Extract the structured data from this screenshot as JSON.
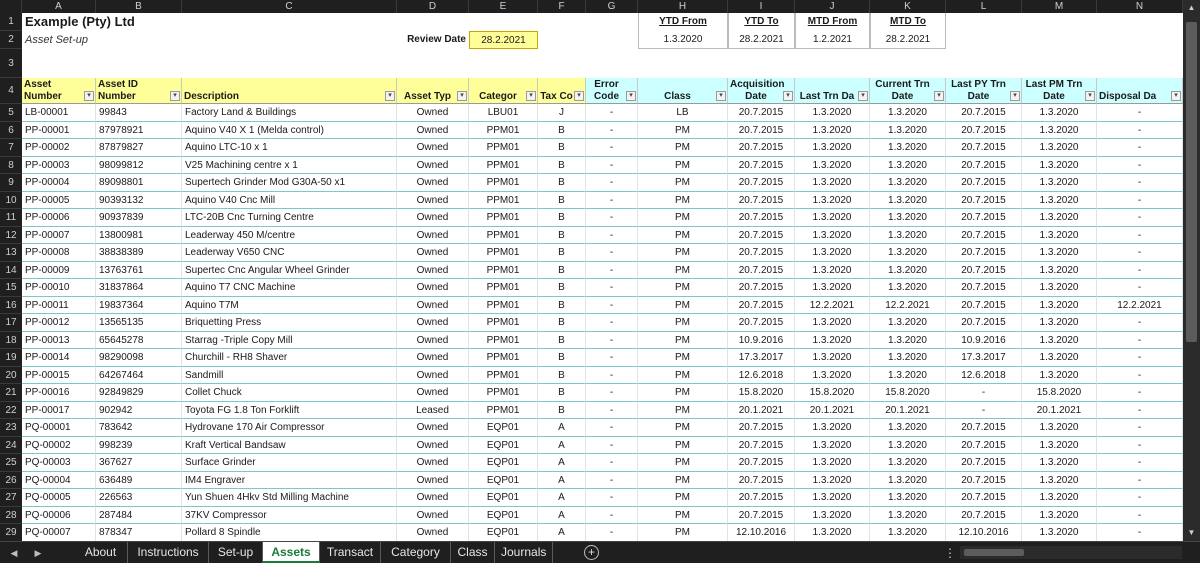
{
  "columns": [
    "A",
    "B",
    "C",
    "D",
    "E",
    "F",
    "G",
    "H",
    "I",
    "J",
    "K",
    "L",
    "M",
    "N"
  ],
  "company": "Example (Pty) Ltd",
  "subtitle": "Asset Set-up",
  "review_label": "Review Date",
  "review_date": "28.2.2021",
  "period_headers": {
    "ytd_from": "YTD From",
    "ytd_to": "YTD To",
    "mtd_from": "MTD From",
    "mtd_to": "MTD To"
  },
  "period_values": {
    "ytd_from": "1.3.2020",
    "ytd_to": "28.2.2021",
    "mtd_from": "1.2.2021",
    "mtd_to": "28.2.2021"
  },
  "headers": {
    "A": [
      "Asset",
      "Number"
    ],
    "B": [
      "Asset ID",
      "Number"
    ],
    "C": [
      "",
      "Description"
    ],
    "D": [
      "",
      "Asset Typ"
    ],
    "E": [
      "",
      "Categor"
    ],
    "F": [
      "",
      "Tax Co"
    ],
    "G": [
      "Error",
      "Code"
    ],
    "H": [
      "",
      "Class"
    ],
    "I": [
      "Acquisition",
      "Date"
    ],
    "J": [
      "",
      "Last Trn Da"
    ],
    "K": [
      "Current Trn",
      "Date"
    ],
    "L": [
      "Last PY Trn",
      "Date"
    ],
    "M": [
      "Last PM Trn",
      "Date"
    ],
    "N": [
      "",
      "Disposal Da"
    ]
  },
  "rows": [
    {
      "n": "5",
      "a": "LB-00001",
      "b": "99843",
      "c": "Factory Land & Buildings",
      "d": "Owned",
      "e": "LBU01",
      "f": "J",
      "g": "-",
      "h": "LB",
      "i": "20.7.2015",
      "j": "1.3.2020",
      "k": "1.3.2020",
      "l": "20.7.2015",
      "m": "1.3.2020",
      "o": "-"
    },
    {
      "n": "6",
      "a": "PP-00001",
      "b": "87978921",
      "c": "Aquino V40 X 1 (Melda control)",
      "d": "Owned",
      "e": "PPM01",
      "f": "B",
      "g": "-",
      "h": "PM",
      "i": "20.7.2015",
      "j": "1.3.2020",
      "k": "1.3.2020",
      "l": "20.7.2015",
      "m": "1.3.2020",
      "o": "-"
    },
    {
      "n": "7",
      "a": "PP-00002",
      "b": "87879827",
      "c": "Aquino LTC-10 x 1",
      "d": "Owned",
      "e": "PPM01",
      "f": "B",
      "g": "-",
      "h": "PM",
      "i": "20.7.2015",
      "j": "1.3.2020",
      "k": "1.3.2020",
      "l": "20.7.2015",
      "m": "1.3.2020",
      "o": "-"
    },
    {
      "n": "8",
      "a": "PP-00003",
      "b": "98099812",
      "c": "V25 Machining centre x 1",
      "d": "Owned",
      "e": "PPM01",
      "f": "B",
      "g": "-",
      "h": "PM",
      "i": "20.7.2015",
      "j": "1.3.2020",
      "k": "1.3.2020",
      "l": "20.7.2015",
      "m": "1.3.2020",
      "o": "-"
    },
    {
      "n": "9",
      "a": "PP-00004",
      "b": "89098801",
      "c": "Supertech Grinder Mod G30A-50 x1",
      "d": "Owned",
      "e": "PPM01",
      "f": "B",
      "g": "-",
      "h": "PM",
      "i": "20.7.2015",
      "j": "1.3.2020",
      "k": "1.3.2020",
      "l": "20.7.2015",
      "m": "1.3.2020",
      "o": "-"
    },
    {
      "n": "10",
      "a": "PP-00005",
      "b": "90393132",
      "c": "Aquino V40 Cnc Mill",
      "d": "Owned",
      "e": "PPM01",
      "f": "B",
      "g": "-",
      "h": "PM",
      "i": "20.7.2015",
      "j": "1.3.2020",
      "k": "1.3.2020",
      "l": "20.7.2015",
      "m": "1.3.2020",
      "o": "-"
    },
    {
      "n": "11",
      "a": "PP-00006",
      "b": "90937839",
      "c": "LTC-20B Cnc Turning Centre",
      "d": "Owned",
      "e": "PPM01",
      "f": "B",
      "g": "-",
      "h": "PM",
      "i": "20.7.2015",
      "j": "1.3.2020",
      "k": "1.3.2020",
      "l": "20.7.2015",
      "m": "1.3.2020",
      "o": "-"
    },
    {
      "n": "12",
      "a": "PP-00007",
      "b": "13800981",
      "c": "Leaderway 450 M/centre",
      "d": "Owned",
      "e": "PPM01",
      "f": "B",
      "g": "-",
      "h": "PM",
      "i": "20.7.2015",
      "j": "1.3.2020",
      "k": "1.3.2020",
      "l": "20.7.2015",
      "m": "1.3.2020",
      "o": "-"
    },
    {
      "n": "13",
      "a": "PP-00008",
      "b": "38838389",
      "c": "Leaderway V650 CNC",
      "d": "Owned",
      "e": "PPM01",
      "f": "B",
      "g": "-",
      "h": "PM",
      "i": "20.7.2015",
      "j": "1.3.2020",
      "k": "1.3.2020",
      "l": "20.7.2015",
      "m": "1.3.2020",
      "o": "-"
    },
    {
      "n": "14",
      "a": "PP-00009",
      "b": "13763761",
      "c": "Supertec Cnc Angular Wheel Grinder",
      "d": "Owned",
      "e": "PPM01",
      "f": "B",
      "g": "-",
      "h": "PM",
      "i": "20.7.2015",
      "j": "1.3.2020",
      "k": "1.3.2020",
      "l": "20.7.2015",
      "m": "1.3.2020",
      "o": "-"
    },
    {
      "n": "15",
      "a": "PP-00010",
      "b": "31837864",
      "c": "Aquino T7 CNC Machine",
      "d": "Owned",
      "e": "PPM01",
      "f": "B",
      "g": "-",
      "h": "PM",
      "i": "20.7.2015",
      "j": "1.3.2020",
      "k": "1.3.2020",
      "l": "20.7.2015",
      "m": "1.3.2020",
      "o": "-"
    },
    {
      "n": "16",
      "a": "PP-00011",
      "b": "19837364",
      "c": "Aquino T7M",
      "d": "Owned",
      "e": "PPM01",
      "f": "B",
      "g": "-",
      "h": "PM",
      "i": "20.7.2015",
      "j": "12.2.2021",
      "k": "12.2.2021",
      "l": "20.7.2015",
      "m": "1.3.2020",
      "o": "12.2.2021"
    },
    {
      "n": "17",
      "a": "PP-00012",
      "b": "13565135",
      "c": "Briquetting Press",
      "d": "Owned",
      "e": "PPM01",
      "f": "B",
      "g": "-",
      "h": "PM",
      "i": "20.7.2015",
      "j": "1.3.2020",
      "k": "1.3.2020",
      "l": "20.7.2015",
      "m": "1.3.2020",
      "o": "-"
    },
    {
      "n": "18",
      "a": "PP-00013",
      "b": "65645278",
      "c": "Starrag -Triple Copy Mill",
      "d": "Owned",
      "e": "PPM01",
      "f": "B",
      "g": "-",
      "h": "PM",
      "i": "10.9.2016",
      "j": "1.3.2020",
      "k": "1.3.2020",
      "l": "10.9.2016",
      "m": "1.3.2020",
      "o": "-"
    },
    {
      "n": "19",
      "a": "PP-00014",
      "b": "98290098",
      "c": "Churchill - RH8 Shaver",
      "d": "Owned",
      "e": "PPM01",
      "f": "B",
      "g": "-",
      "h": "PM",
      "i": "17.3.2017",
      "j": "1.3.2020",
      "k": "1.3.2020",
      "l": "17.3.2017",
      "m": "1.3.2020",
      "o": "-"
    },
    {
      "n": "20",
      "a": "PP-00015",
      "b": "64267464",
      "c": "Sandmill",
      "d": "Owned",
      "e": "PPM01",
      "f": "B",
      "g": "-",
      "h": "PM",
      "i": "12.6.2018",
      "j": "1.3.2020",
      "k": "1.3.2020",
      "l": "12.6.2018",
      "m": "1.3.2020",
      "o": "-"
    },
    {
      "n": "21",
      "a": "PP-00016",
      "b": "92849829",
      "c": "Collet Chuck",
      "d": "Owned",
      "e": "PPM01",
      "f": "B",
      "g": "-",
      "h": "PM",
      "i": "15.8.2020",
      "j": "15.8.2020",
      "k": "15.8.2020",
      "l": "-",
      "m": "15.8.2020",
      "o": "-"
    },
    {
      "n": "22",
      "a": "PP-00017",
      "b": "902942",
      "c": "Toyota FG 1.8 Ton Forklift",
      "d": "Leased",
      "e": "PPM01",
      "f": "B",
      "g": "-",
      "h": "PM",
      "i": "20.1.2021",
      "j": "20.1.2021",
      "k": "20.1.2021",
      "l": "-",
      "m": "20.1.2021",
      "o": "-"
    },
    {
      "n": "23",
      "a": "PQ-00001",
      "b": "783642",
      "c": "Hydrovane 170 Air Compressor",
      "d": "Owned",
      "e": "EQP01",
      "f": "A",
      "g": "-",
      "h": "PM",
      "i": "20.7.2015",
      "j": "1.3.2020",
      "k": "1.3.2020",
      "l": "20.7.2015",
      "m": "1.3.2020",
      "o": "-"
    },
    {
      "n": "24",
      "a": "PQ-00002",
      "b": "998239",
      "c": "Kraft Vertical Bandsaw",
      "d": "Owned",
      "e": "EQP01",
      "f": "A",
      "g": "-",
      "h": "PM",
      "i": "20.7.2015",
      "j": "1.3.2020",
      "k": "1.3.2020",
      "l": "20.7.2015",
      "m": "1.3.2020",
      "o": "-"
    },
    {
      "n": "25",
      "a": "PQ-00003",
      "b": "367627",
      "c": "Surface Grinder",
      "d": "Owned",
      "e": "EQP01",
      "f": "A",
      "g": "-",
      "h": "PM",
      "i": "20.7.2015",
      "j": "1.3.2020",
      "k": "1.3.2020",
      "l": "20.7.2015",
      "m": "1.3.2020",
      "o": "-"
    },
    {
      "n": "26",
      "a": "PQ-00004",
      "b": "636489",
      "c": "IM4 Engraver",
      "d": "Owned",
      "e": "EQP01",
      "f": "A",
      "g": "-",
      "h": "PM",
      "i": "20.7.2015",
      "j": "1.3.2020",
      "k": "1.3.2020",
      "l": "20.7.2015",
      "m": "1.3.2020",
      "o": "-"
    },
    {
      "n": "27",
      "a": "PQ-00005",
      "b": "226563",
      "c": "Yun Shuen 4Hkv Std Milling Machine",
      "d": "Owned",
      "e": "EQP01",
      "f": "A",
      "g": "-",
      "h": "PM",
      "i": "20.7.2015",
      "j": "1.3.2020",
      "k": "1.3.2020",
      "l": "20.7.2015",
      "m": "1.3.2020",
      "o": "-"
    },
    {
      "n": "28",
      "a": "PQ-00006",
      "b": "287484",
      "c": "37KV Compressor",
      "d": "Owned",
      "e": "EQP01",
      "f": "A",
      "g": "-",
      "h": "PM",
      "i": "20.7.2015",
      "j": "1.3.2020",
      "k": "1.3.2020",
      "l": "20.7.2015",
      "m": "1.3.2020",
      "o": "-"
    },
    {
      "n": "29",
      "a": "PQ-00007",
      "b": "878347",
      "c": "Pollard 8 Spindle",
      "d": "Owned",
      "e": "EQP01",
      "f": "A",
      "g": "-",
      "h": "PM",
      "i": "12.10.2016",
      "j": "1.3.2020",
      "k": "1.3.2020",
      "l": "12.10.2016",
      "m": "1.3.2020",
      "o": "-"
    }
  ],
  "tabs": [
    "About",
    "Instructions",
    "Set-up",
    "Assets",
    "Transact",
    "Category",
    "Class",
    "Journals"
  ],
  "active_tab": "Assets",
  "icons": {
    "prev": "triangle-left-icon",
    "next": "triangle-right-icon",
    "add": "plus-circle-icon",
    "options": "vertical-ellipsis-icon"
  },
  "colors": {
    "header_yellow": "#ffff99",
    "header_cyan": "#ccffff",
    "active_tab_green": "#1a7a3a",
    "ui_dark": "#1f1f1f"
  }
}
